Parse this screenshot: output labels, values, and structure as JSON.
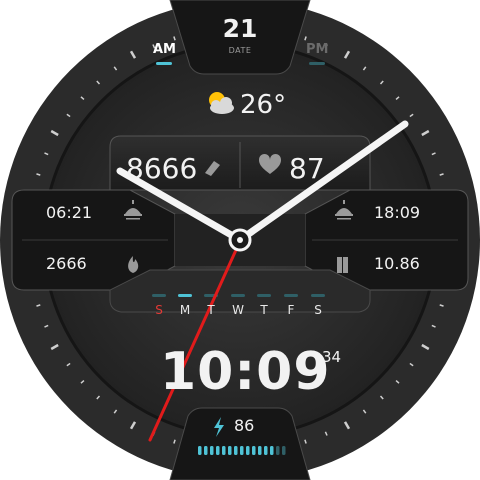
{
  "date": {
    "day": "21",
    "label": "DATE"
  },
  "ampm": {
    "am": "AM",
    "pm": "PM",
    "active": "AM"
  },
  "weather": {
    "temperature": "26°",
    "icon": "partly-cloudy-icon"
  },
  "steps": {
    "value": "8666",
    "icon": "walk-icon"
  },
  "heart_rate": {
    "value": "87",
    "icon": "heart-icon"
  },
  "sunrise": {
    "time": "06:21",
    "icon": "sunrise-icon"
  },
  "sunset": {
    "time": "18:09",
    "icon": "sunset-icon"
  },
  "calories": {
    "value": "2666",
    "icon": "flame-icon"
  },
  "distance": {
    "value": "10.86",
    "icon": "map-icon"
  },
  "week": {
    "days": [
      "S",
      "M",
      "T",
      "W",
      "T",
      "F",
      "S"
    ],
    "current_index": 1
  },
  "digital_time": {
    "hm": "10:09",
    "seconds": "34"
  },
  "analog": {
    "hour": 10,
    "minute": 9,
    "second": 34
  },
  "battery": {
    "value": "86",
    "icon": "bolt-icon",
    "level": 0.86
  },
  "colors": {
    "accent": "#4fc3d6",
    "second_hand": "#e11b1b",
    "text": "#f2f2f2"
  }
}
